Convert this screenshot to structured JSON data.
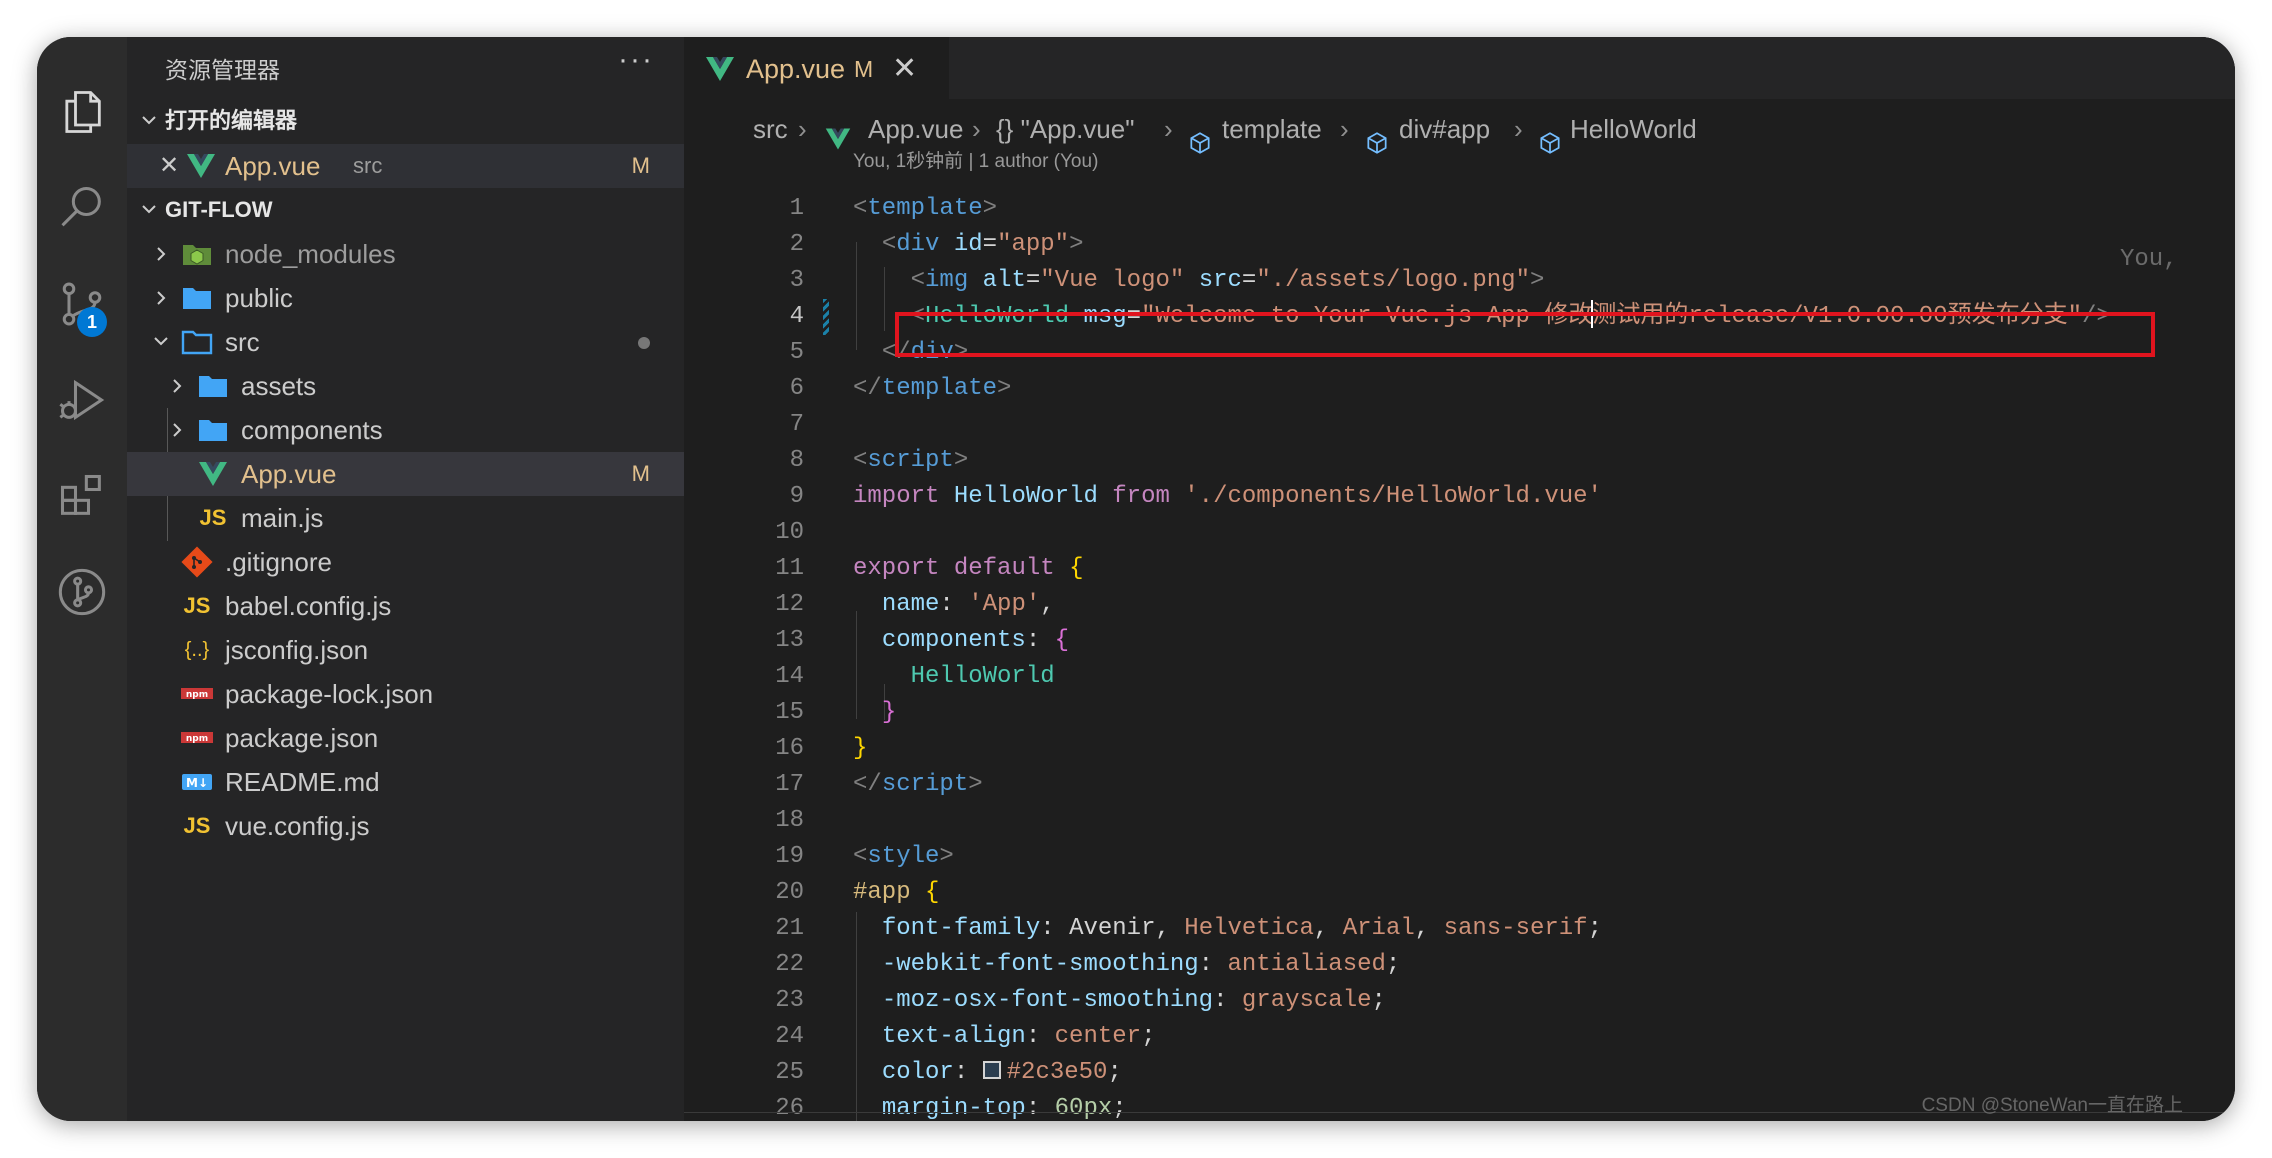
{
  "explorer": {
    "title": "资源管理器",
    "more": "···",
    "open_editors_label": "打开的编辑器",
    "open_editor": {
      "name": "App.vue",
      "path": "src",
      "status": "M"
    },
    "project_label": "GIT-FLOW",
    "tree": [
      {
        "name": "node_modules",
        "kind": "folder-node",
        "expanded": false
      },
      {
        "name": "public",
        "kind": "folder",
        "expanded": false
      },
      {
        "name": "src",
        "kind": "folder",
        "expanded": true
      },
      {
        "name": "assets",
        "kind": "folder",
        "expanded": false
      },
      {
        "name": "components",
        "kind": "folder",
        "expanded": false
      },
      {
        "name": "App.vue",
        "kind": "vue",
        "status": "M"
      },
      {
        "name": "main.js",
        "kind": "js"
      },
      {
        "name": ".gitignore",
        "kind": "git"
      },
      {
        "name": "babel.config.js",
        "kind": "js"
      },
      {
        "name": "jsconfig.json",
        "kind": "json"
      },
      {
        "name": "package-lock.json",
        "kind": "npm"
      },
      {
        "name": "package.json",
        "kind": "npm"
      },
      {
        "name": "README.md",
        "kind": "md"
      },
      {
        "name": "vue.config.js",
        "kind": "js"
      }
    ]
  },
  "activity_bar": {
    "icons": [
      "files-icon",
      "search-icon",
      "source-control-icon",
      "run-debug-icon",
      "extensions-icon",
      "git-graph-icon"
    ],
    "source_control_badge": "1"
  },
  "tab": {
    "label": "App.vue",
    "status": "M",
    "close": "✕"
  },
  "breadcrumb": [
    "src",
    "App.vue",
    "{} \"App.vue\"",
    "template",
    "div#app",
    "HelloWorld"
  ],
  "codelens": "You, 1秒钟前 | 1 author (You)",
  "blame_inline": "You,",
  "line_numbers": [
    "1",
    "2",
    "3",
    "4",
    "5",
    "6",
    "7",
    "8",
    "9",
    "10",
    "11",
    "12",
    "13",
    "14",
    "15",
    "16",
    "17",
    "18",
    "19",
    "20",
    "21",
    "22",
    "23",
    "24",
    "25",
    "26"
  ],
  "code": {
    "l1": {
      "open": "<",
      "tag": "template",
      "close": ">"
    },
    "l2": {
      "open": "<",
      "tag": "div",
      "attr": "id",
      "eq": "=",
      "val": "\"app\"",
      "close": ">"
    },
    "l3": {
      "open": "<",
      "tag": "img",
      "attr1": "alt",
      "eq": "=",
      "val1": "\"Vue logo\"",
      "attr2": "src",
      "val2": "\"./assets/logo.png\"",
      "close": ">"
    },
    "l4": {
      "open": "<",
      "tag": "HelloWorld",
      "attr": "msg",
      "eq": "=",
      "val_a": "\"Welcome to Your Vue.js App 修改",
      "val_b": "测试用的release/V1.0.00.00预发布分支\"",
      "close": "/>"
    },
    "l5": {
      "open": "</",
      "tag": "div",
      "close": ">"
    },
    "l6": {
      "open": "</",
      "tag": "template",
      "close": ">"
    },
    "l8": {
      "open": "<",
      "tag": "script",
      "close": ">"
    },
    "l9": {
      "kw1": "import",
      "id": "HelloWorld",
      "kw2": "from",
      "str": "'./components/HelloWorld.vue'"
    },
    "l11": {
      "kw1": "export",
      "kw2": "default",
      "brace": "{"
    },
    "l12": {
      "key": "name",
      "colon": ": ",
      "str": "'App'",
      "comma": ","
    },
    "l13": {
      "key": "components",
      "colon": ": ",
      "brace": "{"
    },
    "l14": {
      "id": "HelloWorld"
    },
    "l15": {
      "brace": "}"
    },
    "l16": {
      "brace": "}"
    },
    "l17": {
      "open": "</",
      "tag": "script",
      "close": ">"
    },
    "l19": {
      "open": "<",
      "tag": "style",
      "close": ">"
    },
    "l20": {
      "sel": "#app",
      "brace": "{"
    },
    "l21": {
      "prop": "font-family",
      "colon": ": ",
      "v1": "Avenir",
      "c1": ", ",
      "v2": "Helvetica",
      "c2": ", ",
      "v3": "Arial",
      "c3": ", ",
      "v4": "sans-serif",
      "end": ";"
    },
    "l22": {
      "prop": "-webkit-font-smoothing",
      "colon": ": ",
      "val": "antialiased",
      "end": ";"
    },
    "l23": {
      "prop": "-moz-osx-font-smoothing",
      "colon": ": ",
      "val": "grayscale",
      "end": ";"
    },
    "l24": {
      "prop": "text-align",
      "colon": ": ",
      "val": "center",
      "end": ";"
    },
    "l25": {
      "prop": "color",
      "colon": ": ",
      "val": "#2c3e50",
      "end": ";"
    },
    "l26": {
      "prop": "margin-top",
      "colon": ": ",
      "val": "60px",
      "end": ";"
    }
  },
  "watermark": "CSDN @StoneWan一直在路上",
  "colors": {
    "accent_modified": "#e2c08d",
    "highlight_box": "#e0141e",
    "badge": "#0078d4"
  }
}
